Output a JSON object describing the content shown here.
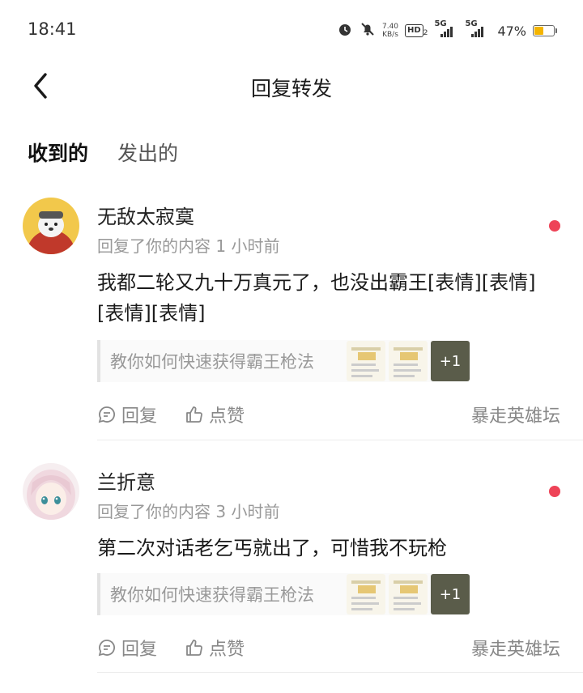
{
  "status_bar": {
    "time": "18:41",
    "speed_value": "7.40",
    "speed_unit": "KB/s",
    "hd_label": "HD",
    "hd_sub": "2",
    "signal_1": "5G",
    "signal_2": "5G",
    "battery_text": "47%",
    "battery_level": 0.47
  },
  "nav": {
    "title": "回复转发"
  },
  "tabs": [
    {
      "label": "收到的",
      "active": true
    },
    {
      "label": "发出的",
      "active": false
    }
  ],
  "replies": [
    {
      "name": "无敌太寂寞",
      "meta": "回复了你的内容 1 小时前",
      "content": "我都二轮又九十万真元了，也没出霸王[表情][表情][表情][表情]",
      "quote_text": "教你如何快速获得霸王枪法",
      "more_images": "+1",
      "reply_label": "回复",
      "like_label": "点赞",
      "forum": "暴走英雄坛"
    },
    {
      "name": "兰折意",
      "meta": "回复了你的内容 3 小时前",
      "content": "第二次对话老乞丐就出了，可惜我不玩枪",
      "quote_text": "教你如何快速获得霸王枪法",
      "more_images": "+1",
      "reply_label": "回复",
      "like_label": "点赞",
      "forum": "暴走英雄坛"
    }
  ],
  "colors": {
    "accent": "#3fd1c6",
    "unread": "#ee4357",
    "battery": "#f4b400"
  }
}
